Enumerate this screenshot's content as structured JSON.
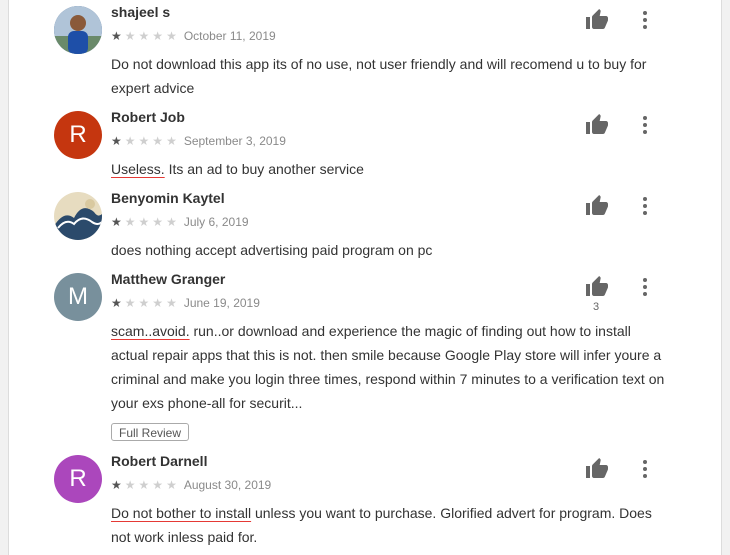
{
  "reviews": [
    {
      "author": "shajeel s",
      "avatar_letter": "",
      "avatar_color": "#3a5a88",
      "rating": 1,
      "date": "October 11, 2019",
      "text": "Do not download this app its of no use, not user friendly and will recomend u to buy for expert advice"
    },
    {
      "author": "Robert Job",
      "avatar_letter": "R",
      "avatar_color": "#c5360f",
      "rating": 1,
      "date": "September 3, 2019",
      "text_underlined": "Useless.",
      "text_rest": " Its an ad to buy another service"
    },
    {
      "author": "Benyomin Kaytel",
      "avatar_letter": "",
      "avatar_color": "#7a8a7a",
      "rating": 1,
      "date": "July 6, 2019",
      "text": "does nothing accept advertising paid program on pc"
    },
    {
      "author": "Matthew Granger",
      "avatar_letter": "M",
      "avatar_color": "#78909c",
      "rating": 1,
      "date": "June 19, 2019",
      "helpful_count": "3",
      "text_underlined": "scam..avoid.",
      "text_rest": " run..or download and experience the magic of finding out how to install actual repair apps that this is not. then smile because Google Play store will infer youre a criminal and make you login three times, respond within 7 minutes to a verification text on your exs phone-all for securit...",
      "full_review_label": "Full Review"
    },
    {
      "author": "Robert Darnell",
      "avatar_letter": "R",
      "avatar_color": "#ab47bc",
      "rating": 1,
      "date": "August 30, 2019",
      "text_underlined": "Do not bother to install",
      "text_rest": " unless you want to purchase. Glorified advert for program. Does not work inless paid for."
    }
  ]
}
